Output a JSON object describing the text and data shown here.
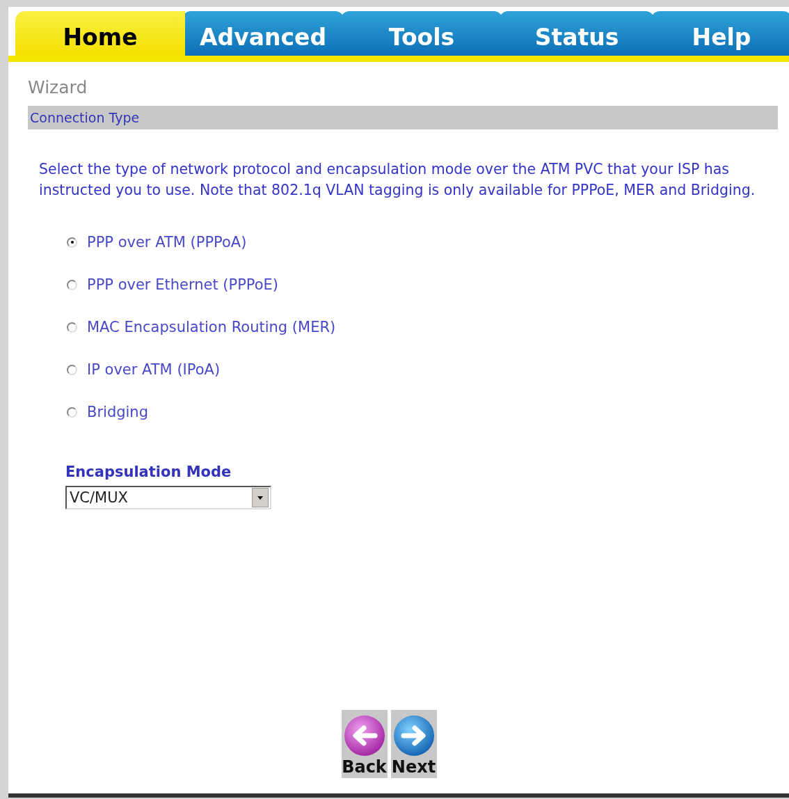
{
  "tabs": [
    {
      "label": "Home",
      "selected": true
    },
    {
      "label": "Advanced",
      "selected": false
    },
    {
      "label": "Tools",
      "selected": false
    },
    {
      "label": "Status",
      "selected": false
    },
    {
      "label": "Help",
      "selected": false
    }
  ],
  "page_title": "Wizard",
  "section_header": "Connection Type",
  "description": "Select the type of network protocol and encapsulation mode over the ATM PVC that your ISP has instructed you to use. Note that 802.1q VLAN tagging is only available for PPPoE, MER and Bridging.",
  "options": [
    {
      "label": "PPP over ATM (PPPoA)",
      "selected": true
    },
    {
      "label": "PPP over Ethernet (PPPoE)",
      "selected": false
    },
    {
      "label": "MAC Encapsulation Routing (MER)",
      "selected": false
    },
    {
      "label": "IP over ATM (IPoA)",
      "selected": false
    },
    {
      "label": "Bridging",
      "selected": false
    }
  ],
  "encapsulation_mode": {
    "label": "Encapsulation Mode",
    "value": "VC/MUX"
  },
  "buttons": [
    {
      "label": "Back",
      "kind": "back"
    },
    {
      "label": "Next",
      "kind": "next"
    }
  ]
}
